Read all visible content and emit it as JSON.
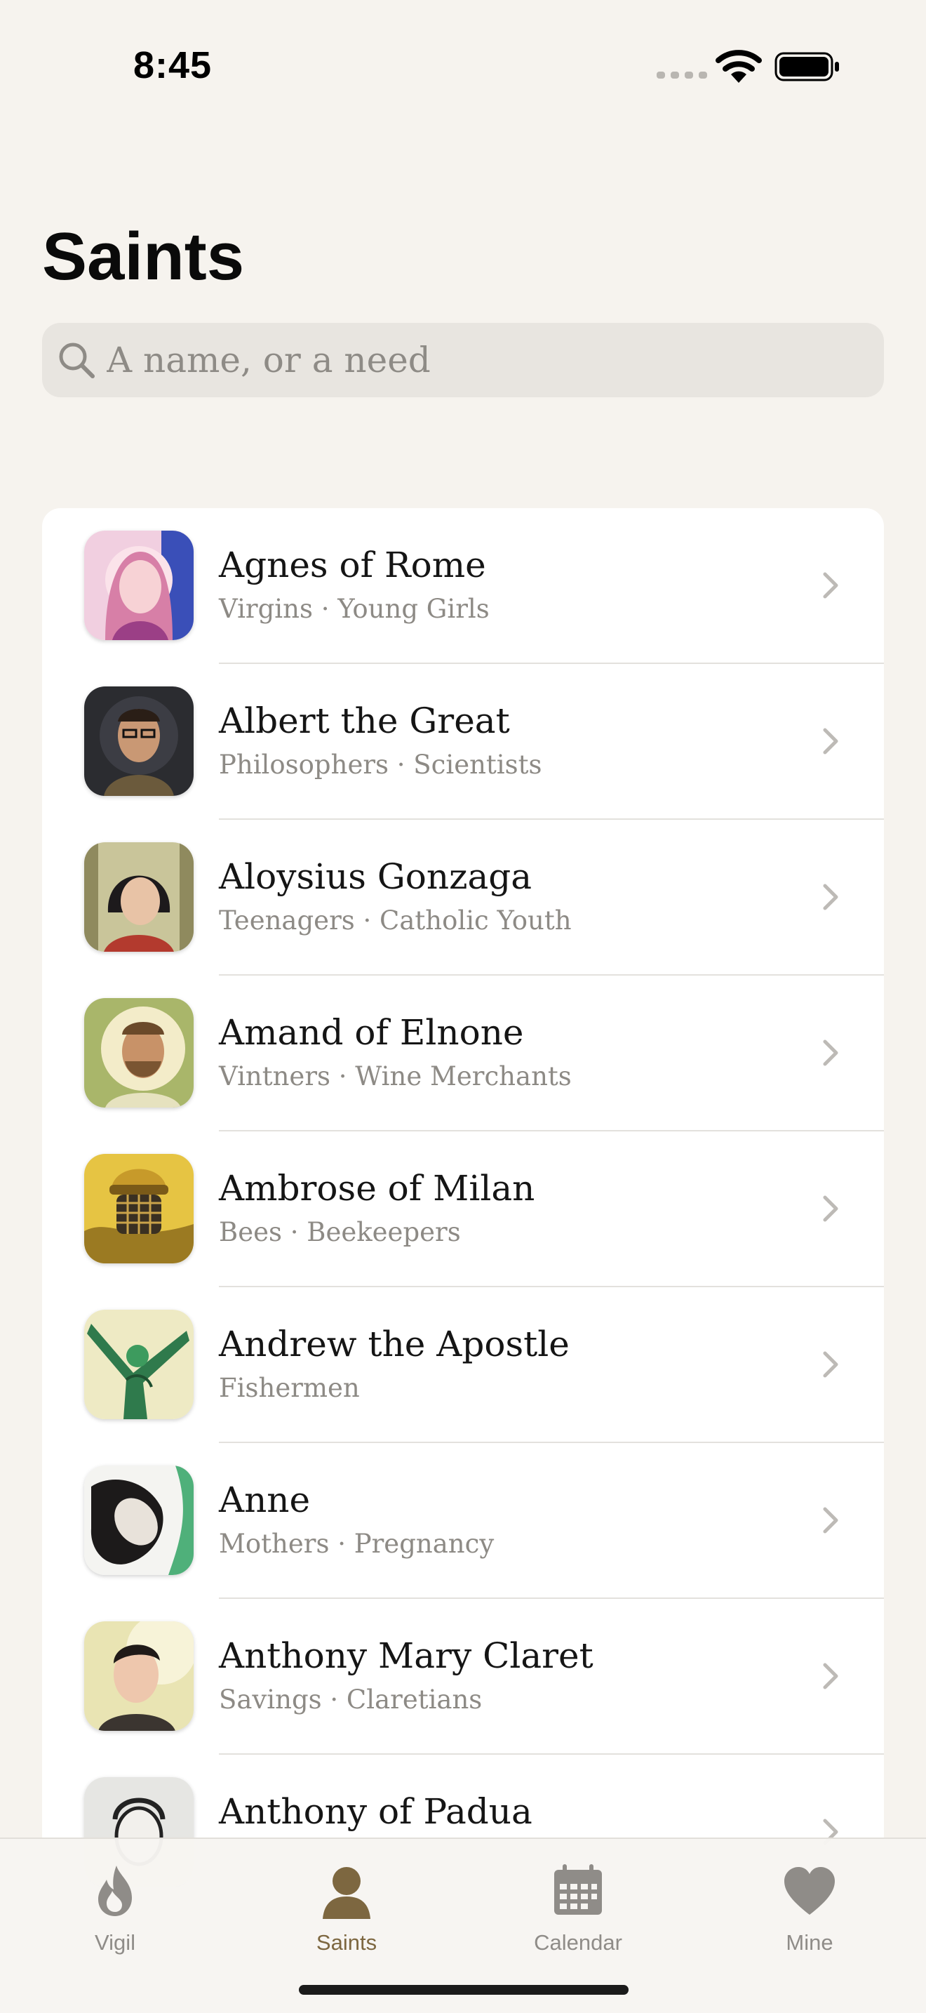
{
  "status_bar": {
    "time": "8:45"
  },
  "header": {
    "title": "Saints"
  },
  "search": {
    "placeholder": "A name, or a need",
    "value": ""
  },
  "saints": [
    {
      "name": "Agnes of Rome",
      "patronage": "Virgins · Young Girls"
    },
    {
      "name": "Albert the Great",
      "patronage": "Philosophers · Scientists"
    },
    {
      "name": "Aloysius Gonzaga",
      "patronage": "Teenagers · Catholic Youth"
    },
    {
      "name": "Amand of Elnone",
      "patronage": "Vintners · Wine Merchants"
    },
    {
      "name": "Ambrose of Milan",
      "patronage": "Bees · Beekeepers"
    },
    {
      "name": "Andrew the Apostle",
      "patronage": "Fishermen"
    },
    {
      "name": "Anne",
      "patronage": "Mothers · Pregnancy"
    },
    {
      "name": "Anthony Mary Claret",
      "patronage": "Savings · Claretians"
    },
    {
      "name": "Anthony of Padua",
      "patronage": ""
    }
  ],
  "tabs": [
    {
      "label": "Vigil",
      "icon": "flame-icon",
      "active": false
    },
    {
      "label": "Saints",
      "icon": "person-icon",
      "active": true
    },
    {
      "label": "Calendar",
      "icon": "calendar-icon",
      "active": false
    },
    {
      "label": "Mine",
      "icon": "heart-icon",
      "active": false
    }
  ],
  "colors": {
    "background": "#f6f3ee",
    "card": "#ffffff",
    "accent_active_tab": "#7d6740",
    "inactive_tab": "#8f8c88",
    "secondary_text": "#8d8a85"
  }
}
